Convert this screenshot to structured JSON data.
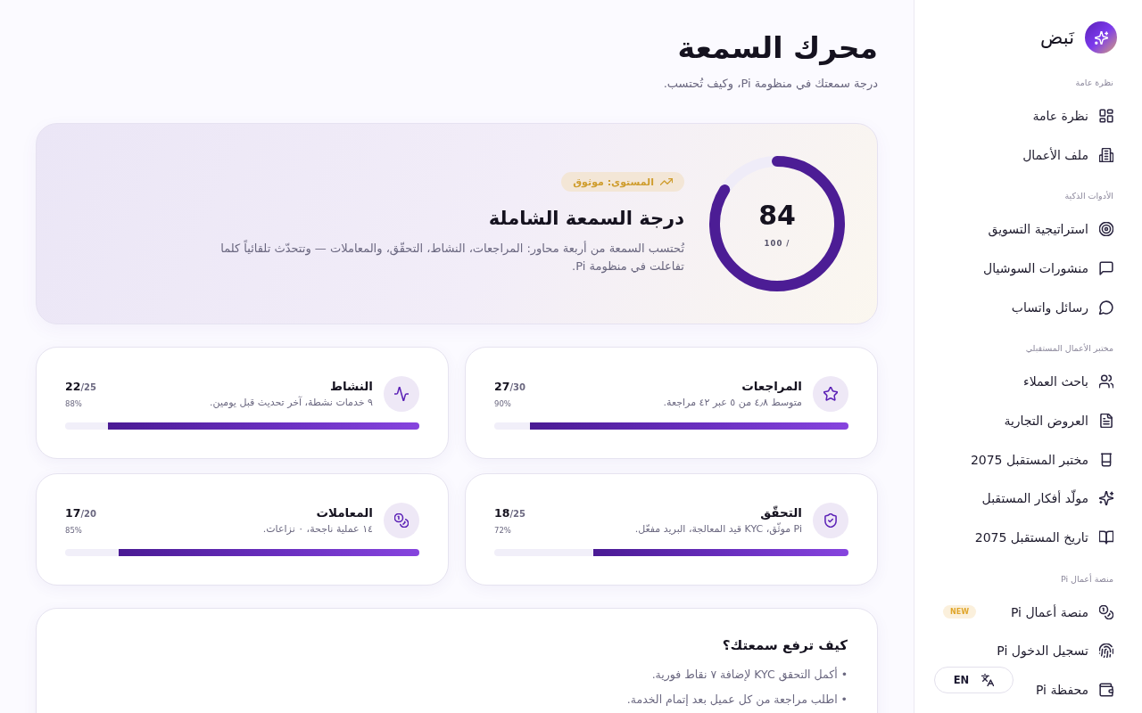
{
  "sidebar": {
    "brand": "نَبض",
    "sections": [
      {
        "label": "نظرة عامة",
        "items": [
          {
            "label": "نظرة عامة",
            "selected": false
          },
          {
            "label": "ملف الأعمال",
            "selected": false
          }
        ]
      },
      {
        "label": "الأدوات الذكية",
        "items": [
          {
            "label": "استراتيجية التسويق",
            "selected": false
          },
          {
            "label": "منشورات السوشيال",
            "selected": false
          },
          {
            "label": "رسائل واتساب",
            "selected": false
          }
        ]
      },
      {
        "label": "مختبر الأعمال المستقبلي",
        "items": [
          {
            "label": "باحث العملاء",
            "selected": false
          },
          {
            "label": "العروض التجارية",
            "selected": false
          },
          {
            "label": "مختبر المستقبل 2075",
            "selected": false
          },
          {
            "label": "مولّد أفكار المستقبل",
            "selected": false
          },
          {
            "label": "تاريخ المستقبل 2075",
            "selected": false
          }
        ]
      },
      {
        "label": "منصة أعمال Pi",
        "items": [
          {
            "label": "منصة أعمال Pi",
            "selected": false,
            "badge": "NEW"
          },
          {
            "label": "تسجيل الدخول Pi",
            "selected": false
          },
          {
            "label": "محفظة Pi",
            "selected": false
          }
        ]
      }
    ],
    "language_button": {
      "label": "EN"
    }
  },
  "header": {
    "title": "محرك السمعة",
    "subtitle": "درجة سمعتك في منظومة Pi، وكيف تُحتسب."
  },
  "overall": {
    "score": "84",
    "out_of": "/ 100",
    "level": 0.84,
    "badge": "المستوى: موثوق",
    "title": "درجة السمعة الشاملة",
    "description": "تُحتسب السمعة من أربعة محاور: المراجعات، النشاط، التحقّق، والمعاملات — وتتحدّث تلقائياً كلما تفاعلت في منظومة Pi."
  },
  "metrics": [
    {
      "title": "المراجعات",
      "detail": "متوسط ٤٫٨ من ٥ عبر ٤٢ مراجعة.",
      "score": "27",
      "out_of": "/30",
      "percent": "90%",
      "level": 0.9
    },
    {
      "title": "النشاط",
      "detail": "٩ خدمات نشطة، آخر تحديث قبل يومين.",
      "score": "22",
      "out_of": "/25",
      "percent": "88%",
      "level": 0.88
    },
    {
      "title": "التحقّق",
      "detail": "Pi موثّق، KYC قيد المعالجة، البريد مفعّل.",
      "score": "18",
      "out_of": "/25",
      "percent": "72%",
      "level": 0.72
    },
    {
      "title": "المعاملات",
      "detail": "١٤ عملية ناجحة، ٠ نزاعات.",
      "score": "17",
      "out_of": "/20",
      "percent": "85%",
      "level": 0.85
    }
  ],
  "tips": {
    "title": "كيف ترفع سمعتك؟",
    "items": [
      "• أكمل التحقق KYC لإضافة ٧ نقاط فورية.",
      "• اطلب مراجعة من كل عميل بعد إتمام الخدمة."
    ]
  }
}
